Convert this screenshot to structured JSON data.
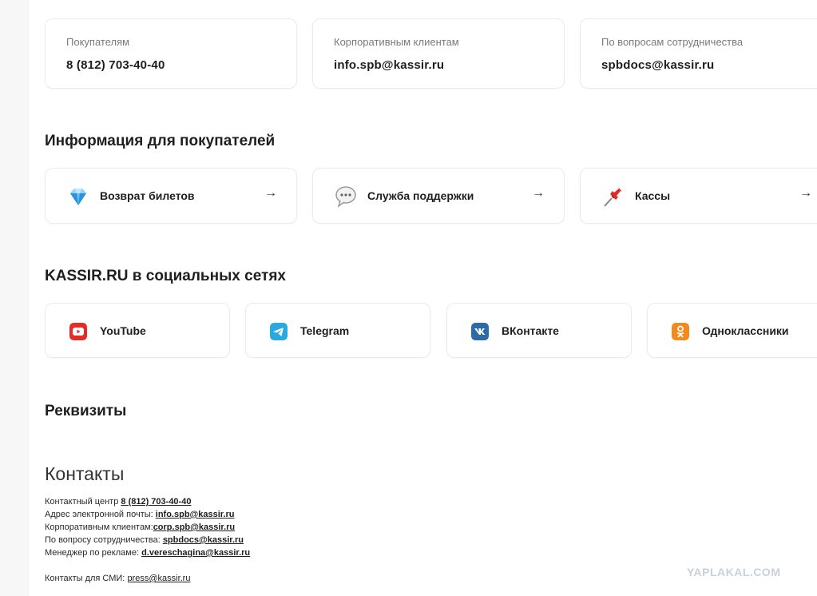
{
  "contact_cards": [
    {
      "label": "Покупателям",
      "value": "8 (812) 703-40-40"
    },
    {
      "label": "Корпоративным клиентам",
      "value": "info.spb@kassir.ru"
    },
    {
      "label": "По вопросам сотрудничества",
      "value": "spbdocs@kassir.ru"
    }
  ],
  "info_section": {
    "title": "Информация для покупателей",
    "items": [
      {
        "label": "Возврат билетов",
        "icon": "gem-icon",
        "arrow": "→"
      },
      {
        "label": "Служба поддержки",
        "icon": "speech-bubble-icon",
        "arrow": "→"
      },
      {
        "label": "Кассы",
        "icon": "pushpin-icon",
        "arrow": "→"
      }
    ]
  },
  "social_section": {
    "title": "KASSIR.RU в социальных сетях",
    "items": [
      {
        "label": "YouTube",
        "icon": "youtube-icon",
        "color": "#e52d27"
      },
      {
        "label": "Telegram",
        "icon": "telegram-icon",
        "color": "#2aa8e0"
      },
      {
        "label": "ВКонтакте",
        "icon": "vk-icon",
        "color": "#2c6aa8"
      },
      {
        "label": "Одноклассники",
        "icon": "ok-icon",
        "color": "#f28a1c"
      }
    ]
  },
  "requisites": {
    "title": "Реквизиты"
  },
  "contacts": {
    "title": "Контакты",
    "lines": [
      {
        "label": "Контактный центр",
        "value": "8 (812) 703-40-40"
      },
      {
        "label": "Адрес электронной почты:",
        "value": "info.spb@kassir.ru"
      },
      {
        "label": "Корпоративным клиентам:",
        "value": "corp.spb@kassir.ru"
      },
      {
        "label": "По вопросу сотрудничества: ",
        "value": "spbdocs@kassir.ru"
      },
      {
        "label": "Менеджер по рекламе:",
        "value": "d.vereschagina@kassir.ru"
      }
    ],
    "media": {
      "label": "Контакты для СМИ:",
      "value": "press@kassir.ru"
    }
  },
  "watermark": "YAPLAKAL.COM"
}
